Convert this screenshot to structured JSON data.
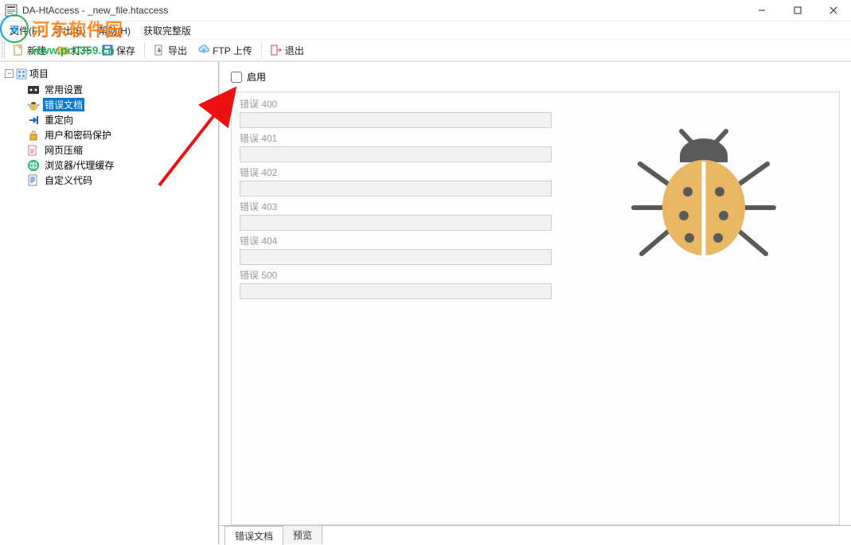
{
  "window": {
    "title": "DA-HtAccess - _new_file.htaccess"
  },
  "menu": {
    "file": "文件(F)",
    "export": "导出(E)",
    "help": "帮助(H)",
    "getfull": "获取完整版"
  },
  "toolbar": {
    "new": "新建",
    "open": "打开",
    "save": "保存",
    "export": "导出",
    "ftp": "FTP 上传",
    "exit": "退出"
  },
  "tree": {
    "root": "项目",
    "items": [
      {
        "label": "常用设置"
      },
      {
        "label": "错误文档"
      },
      {
        "label": "重定向"
      },
      {
        "label": "用户和密码保护"
      },
      {
        "label": "网页压缩"
      },
      {
        "label": "浏览器/代理缓存"
      },
      {
        "label": "自定义代码"
      }
    ],
    "selected_index": 1
  },
  "panel": {
    "enable": "启用",
    "fields": [
      {
        "label": "错误 400"
      },
      {
        "label": "错误 401"
      },
      {
        "label": "错误 402"
      },
      {
        "label": "错误 403"
      },
      {
        "label": "错误 404"
      },
      {
        "label": "错误 500"
      }
    ]
  },
  "tabs": {
    "errdoc": "错误文档",
    "preview": "预览"
  },
  "watermark": {
    "cn": "河东软件园",
    "url": "www.pc0359.cn"
  },
  "colors": {
    "accent": "#0078d7",
    "bug_body": "#e8b864",
    "bug_dark": "#5a5a5a"
  }
}
